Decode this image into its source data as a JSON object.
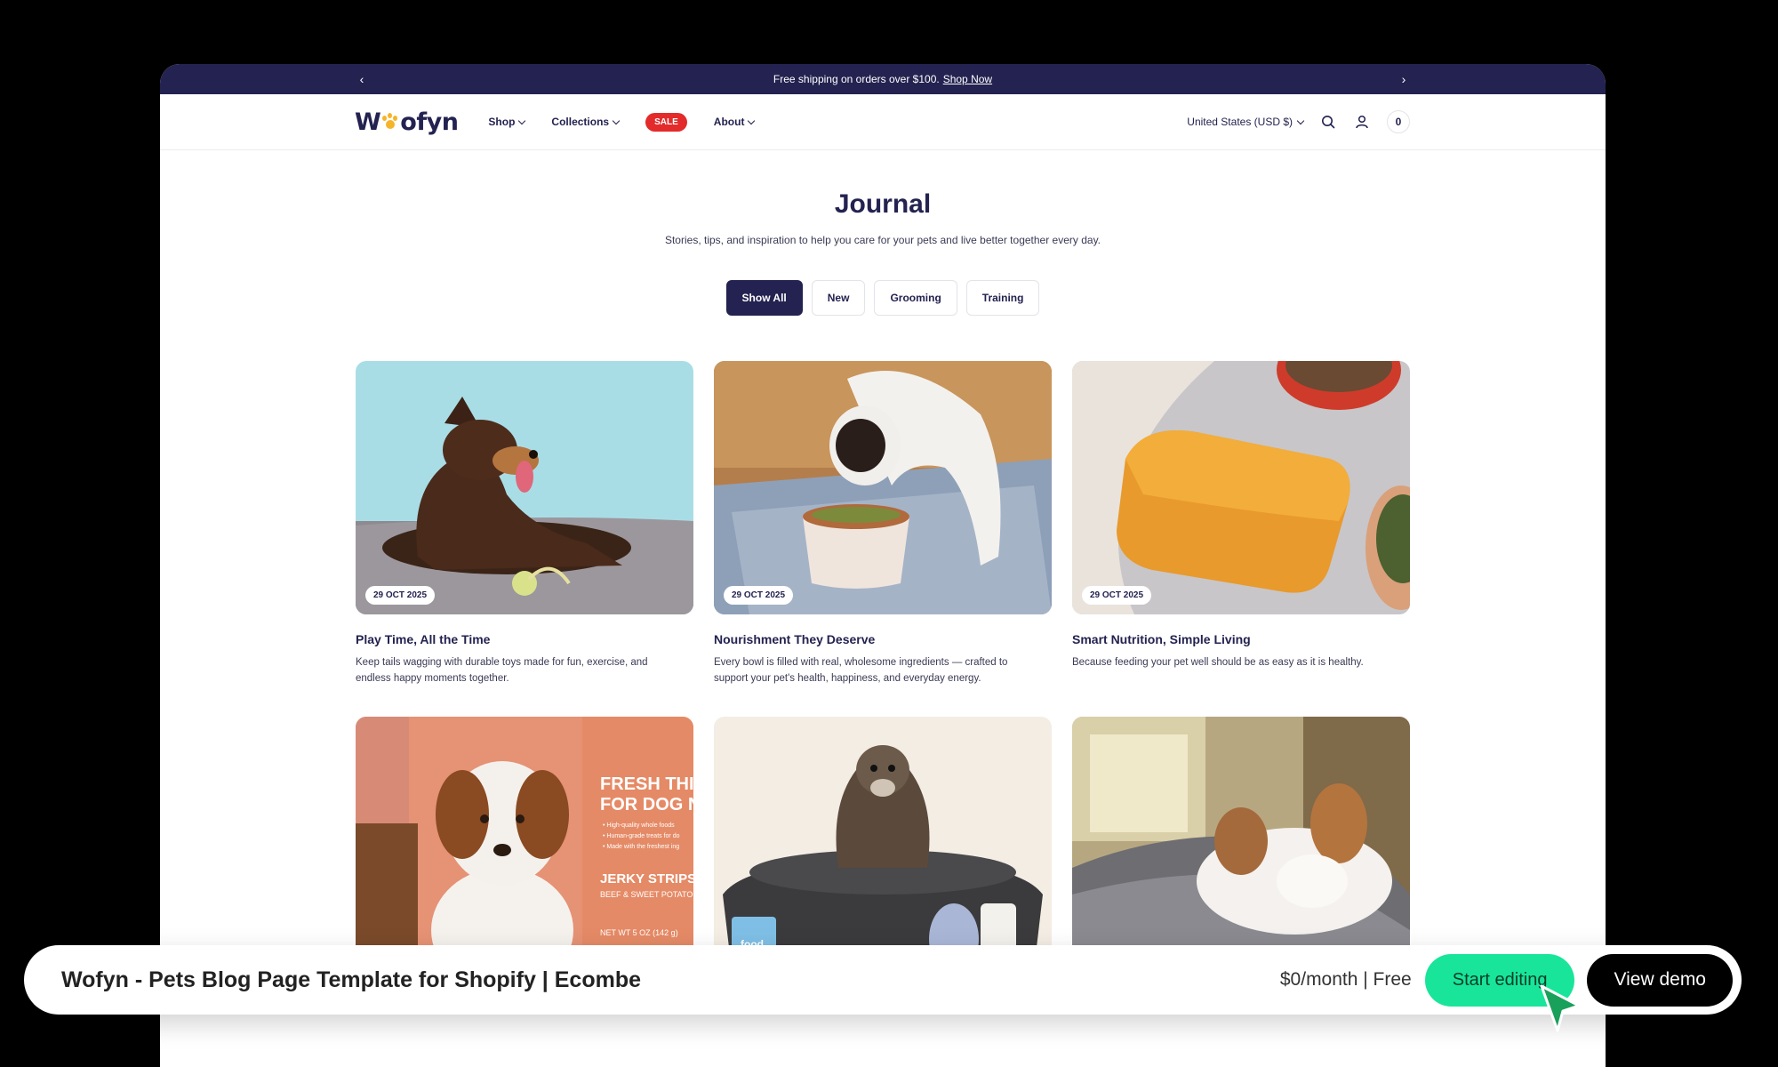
{
  "announcement": {
    "text": "Free shipping on orders over $100.",
    "link": "Shop Now",
    "prev_icon": "chevron-left-icon",
    "next_icon": "chevron-right-icon"
  },
  "header": {
    "logo_left": "W",
    "logo_right": "ofyn",
    "nav": [
      {
        "label": "Shop"
      },
      {
        "label": "Collections"
      },
      {
        "label": "SALE"
      },
      {
        "label": "About"
      }
    ],
    "currency": "United States (USD $)",
    "cart_count": "0"
  },
  "hero": {
    "title": "Journal",
    "subtitle": "Stories, tips, and inspiration to help you care for your pets and live better together every day."
  },
  "filters": [
    {
      "label": "Show All",
      "active": true
    },
    {
      "label": "New"
    },
    {
      "label": "Grooming"
    },
    {
      "label": "Training"
    }
  ],
  "articles": [
    {
      "date": "29 OCT 2025",
      "title": "Play Time, All the Time",
      "desc": "Keep tails wagging with durable toys made for fun, exercise, and endless happy moments together."
    },
    {
      "date": "29 OCT 2025",
      "title": "Nourishment They Deserve",
      "desc": "Every bowl is filled with real, wholesome ingredients — crafted to support your pet's health, happiness, and everyday energy."
    },
    {
      "date": "29 OCT 2025",
      "title": "Smart Nutrition, Simple Living",
      "desc": "Because feeding your pet well should be as easy as it is healthy."
    },
    {
      "packaging_text": [
        "FRESH THINKI",
        "FOR DOG NUTR",
        "• High-quality whole foods",
        "• Human-grade treats for do",
        "• Made with the freshest ing",
        "JERKY STRIPS",
        "BEEF & SWEET POTATO RECIPE",
        "NET WT 5 OZ (142 g)"
      ]
    },
    {
      "package_label": "food"
    },
    {}
  ],
  "bottom_bar": {
    "title": "Wofyn - Pets Blog Page Template for Shopify | Ecombe",
    "price": "$0/month | Free",
    "start_label": "Start editing",
    "demo_label": "View demo"
  },
  "colors": {
    "navy": "#232250",
    "sale": "#e32b2b",
    "accent_green": "#19e59a",
    "logo_paw": "#f5b42a"
  }
}
